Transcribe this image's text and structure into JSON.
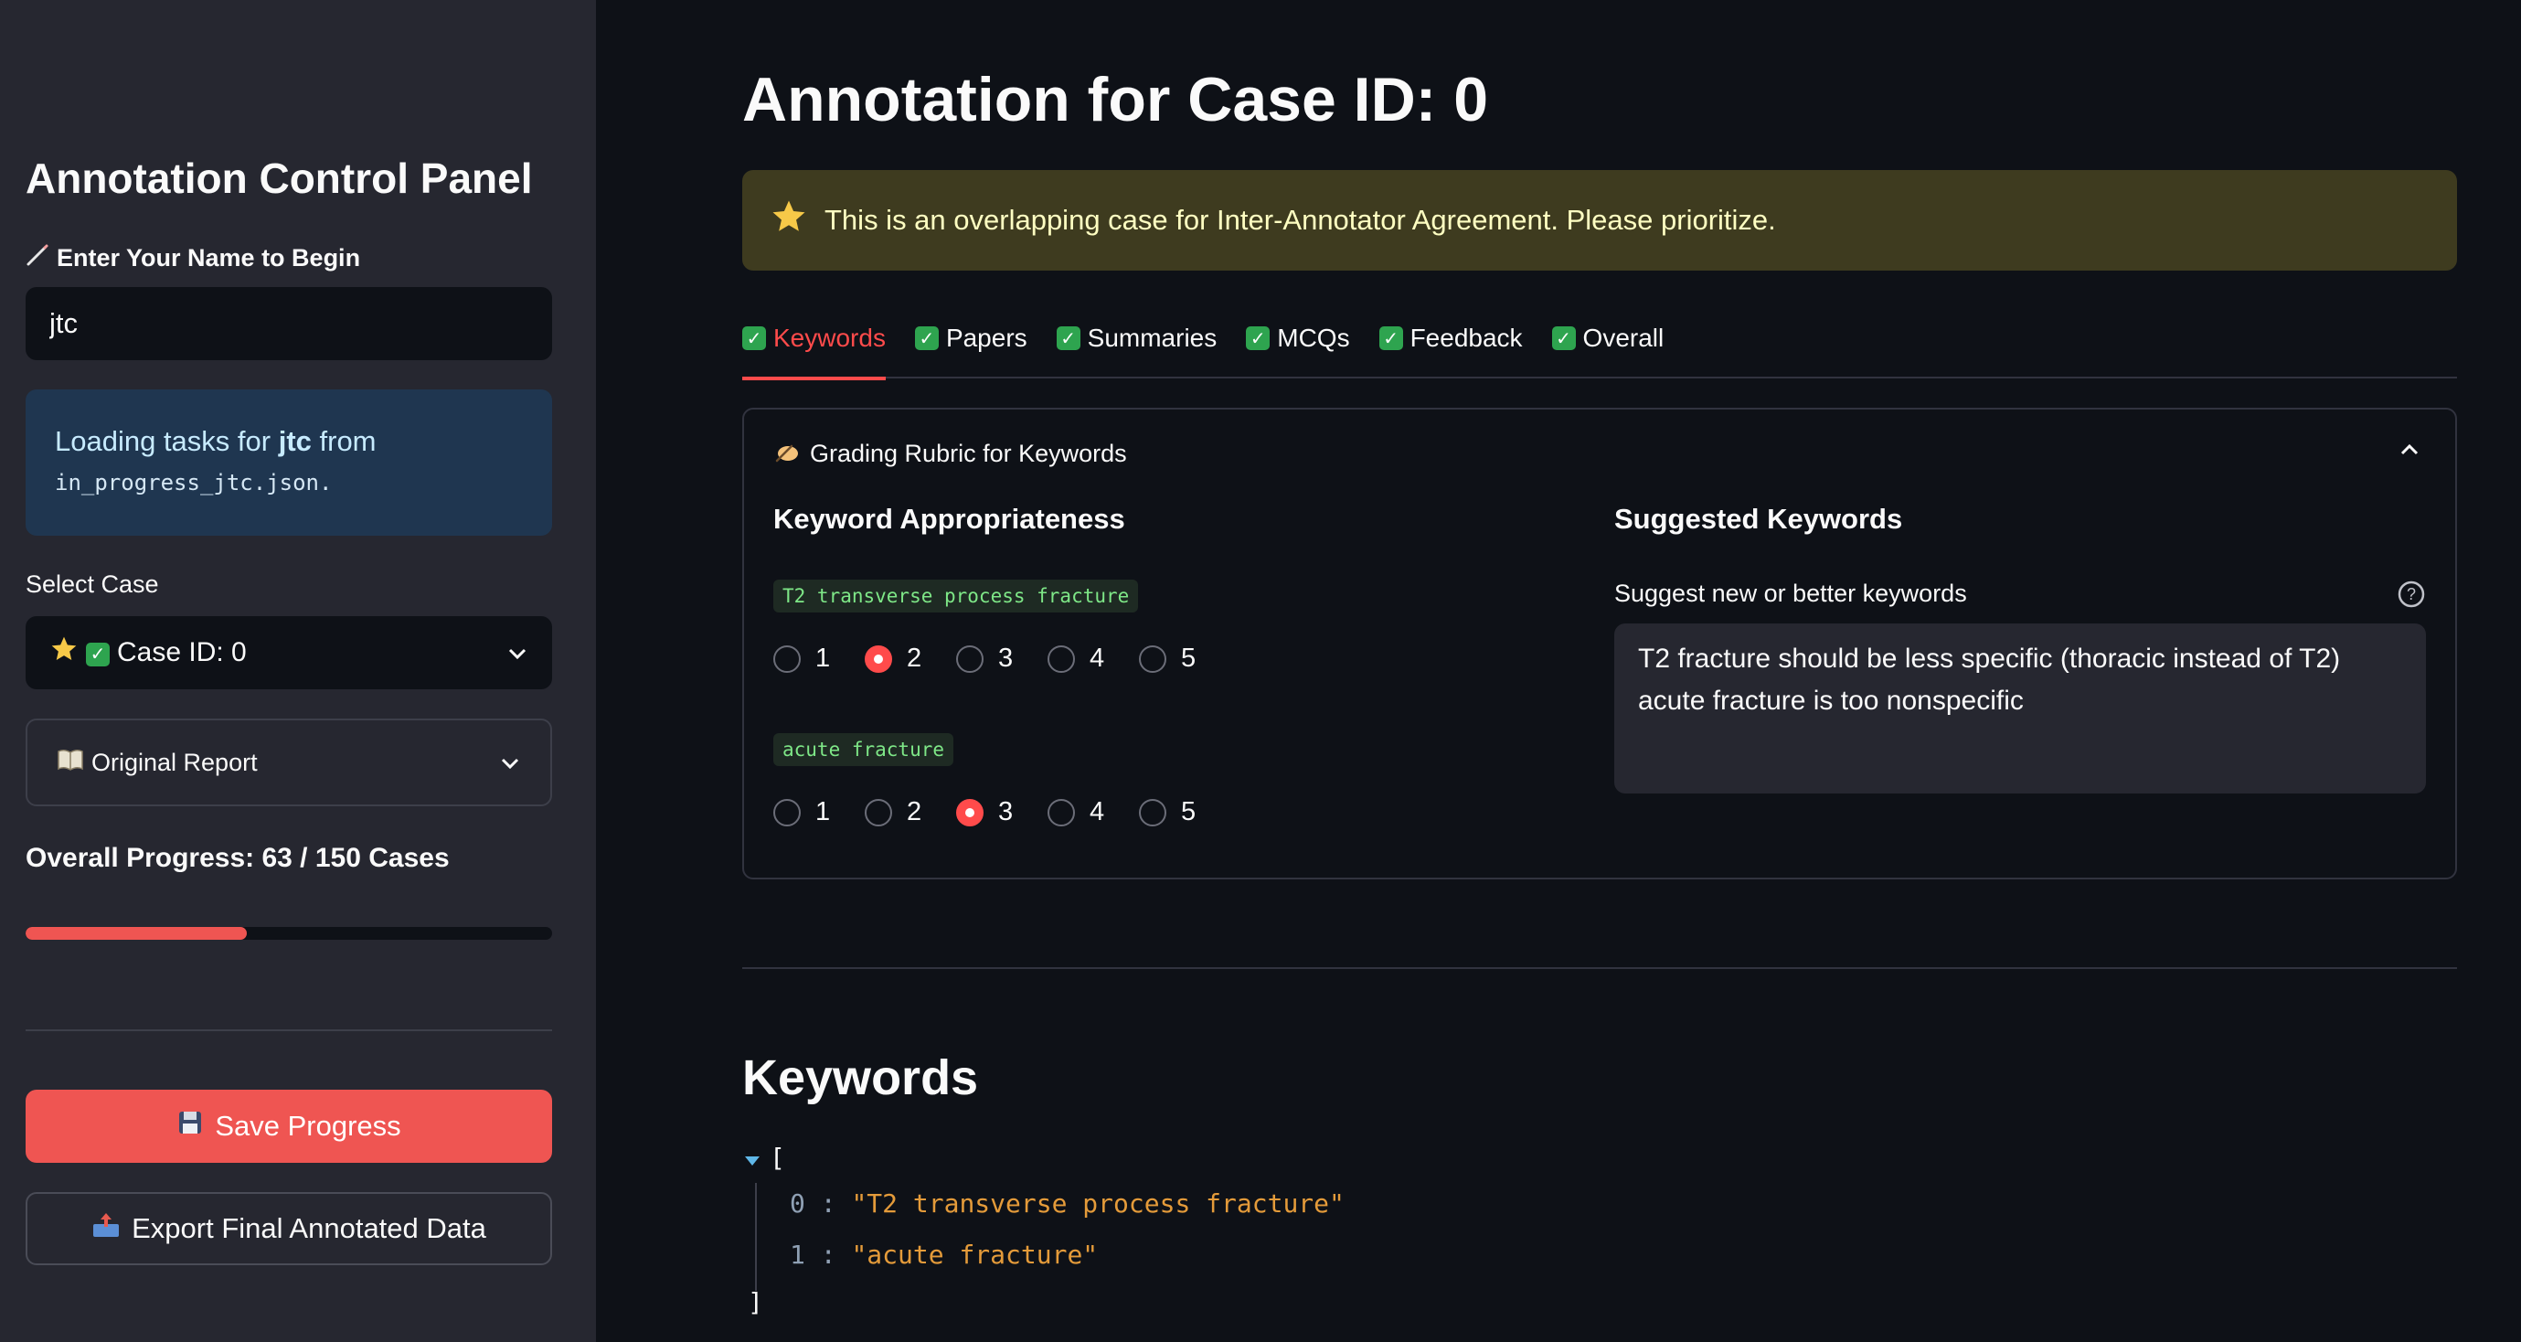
{
  "sidebar": {
    "title": "Annotation Control Panel",
    "name_label": "Enter Your Name to Begin",
    "name_value": "jtc",
    "info": {
      "prefix": "Loading tasks for ",
      "user": "jtc",
      "suffix": " from",
      "file": "in_progress_jtc.json."
    },
    "select_case_label": "Select Case",
    "select_case_value": "Case ID: 0",
    "original_report_label": "Original Report",
    "progress_label": "Overall Progress: 63 / 150 Cases",
    "progress_fraction": 0.42,
    "save_button": "Save Progress",
    "export_button": "Export Final Annotated Data"
  },
  "main": {
    "title": "Annotation for Case ID: 0",
    "warning": "This is an overlapping case for Inter-Annotator Agreement. Please prioritize.",
    "tabs": [
      {
        "label": "Keywords",
        "active": true
      },
      {
        "label": "Papers",
        "active": false
      },
      {
        "label": "Summaries",
        "active": false
      },
      {
        "label": "MCQs",
        "active": false
      },
      {
        "label": "Feedback",
        "active": false
      },
      {
        "label": "Overall",
        "active": false
      }
    ],
    "rubric": {
      "header": "Grading Rubric for Keywords",
      "left_title": "Keyword Appropriateness",
      "right_title": "Suggested Keywords",
      "keywords": [
        {
          "text": "T2 transverse process fracture",
          "selected": 2
        },
        {
          "text": "acute fracture",
          "selected": 3
        }
      ],
      "options": [
        "1",
        "2",
        "3",
        "4",
        "5"
      ],
      "suggest_label": "Suggest new or better keywords",
      "suggest_value": "T2 fracture should be less specific (thoracic instead of T2)\nacute fracture is too nonspecific"
    },
    "keywords_heading": "Keywords",
    "json": {
      "open": "[",
      "close": "]",
      "items": [
        {
          "index": "0",
          "value": "\"T2 transverse process fracture\""
        },
        {
          "index": "1",
          "value": "\"acute fracture\""
        }
      ]
    }
  }
}
